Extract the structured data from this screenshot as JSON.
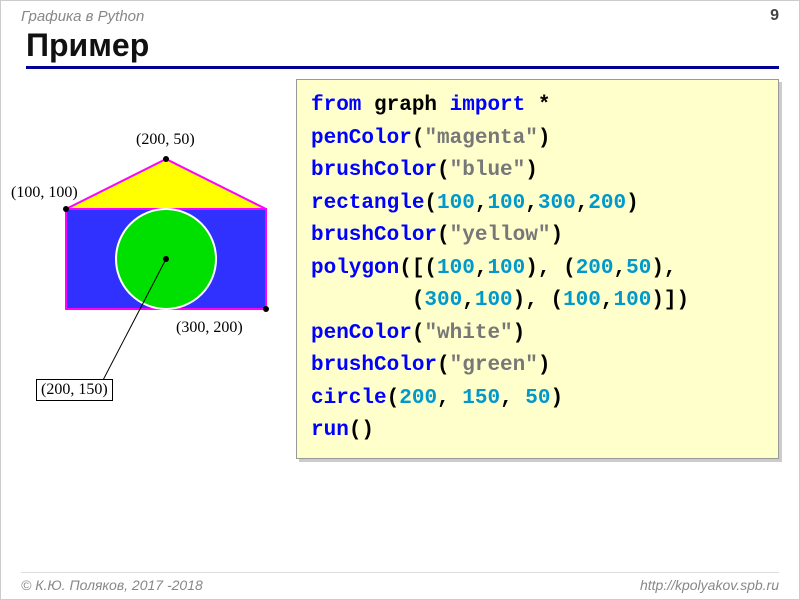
{
  "header": {
    "section": "Графика в Python",
    "page": "9"
  },
  "title": "Пример",
  "diagram": {
    "labels": {
      "top": "(200, 50)",
      "left": "(100, 100)",
      "bottom_right": "(300, 200)",
      "center": "(200, 150)"
    }
  },
  "code": {
    "l1a": "from",
    "l1b": " graph ",
    "l1c": "import",
    "l1d": " *",
    "l2a": "penColor",
    "l2b": "(",
    "l2c": "\"magenta\"",
    "l2d": ")",
    "l3a": "brushColor",
    "l3b": "(",
    "l3c": "\"blue\"",
    "l3d": ")",
    "l4a": "rectangle",
    "l4b": "(",
    "l4n1": "100",
    "l4c": ",",
    "l4n2": "100",
    "l4d": ",",
    "l4n3": "300",
    "l4e": ",",
    "l4n4": "200",
    "l4f": ")",
    "l5a": "brushColor",
    "l5b": "(",
    "l5c": "\"yellow\"",
    "l5d": ")",
    "l6a": "polygon",
    "l6b": "([(",
    "l6n1": "100",
    "l6c": ",",
    "l6n2": "100",
    "l6d": "), (",
    "l6n3": "200",
    "l6e": ",",
    "l6n4": "50",
    "l6f": "),",
    "l7pad": "        (",
    "l7n1": "300",
    "l7a": ",",
    "l7n2": "100",
    "l7b": "), (",
    "l7n3": "100",
    "l7c": ",",
    "l7n4": "100",
    "l7d": ")])",
    "l8a": "penColor",
    "l8b": "(",
    "l8c": "\"white\"",
    "l8d": ")",
    "l9a": "brushColor",
    "l9b": "(",
    "l9c": "\"green\"",
    "l9d": ")",
    "l10a": "circle",
    "l10b": "(",
    "l10n1": "200",
    "l10c": ", ",
    "l10n2": "150",
    "l10d": ", ",
    "l10n3": "50",
    "l10e": ")",
    "l11a": "run",
    "l11b": "()"
  },
  "footer": {
    "left": "© К.Ю. Поляков, 2017 -2018",
    "right": "http://kpolyakov.spb.ru"
  }
}
